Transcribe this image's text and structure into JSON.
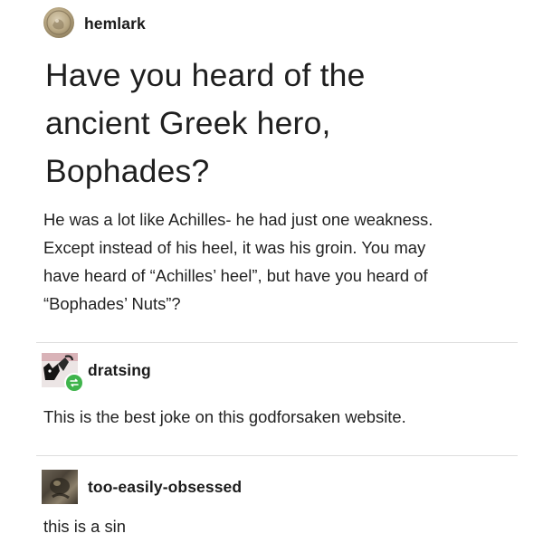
{
  "op": {
    "username": "hemlark",
    "title_lines": [
      "Have you heard of the",
      "ancient Greek hero,",
      "Bophades?"
    ],
    "body_lines": [
      "He was a lot like Achilles- he had just one weakness.",
      "Except instead of his heel, it was his groin. You may",
      "have heard of “Achilles’ heel”, but have you heard of",
      "“Bophades’ Nuts”?"
    ]
  },
  "replies": [
    {
      "username": "dratsing",
      "text": "This is the best joke on this godforsaken website.",
      "badge_icon": "reblog-icon",
      "badge_color": "#3fb44c"
    },
    {
      "username": "too-easily-obsessed",
      "text": "this is a sin"
    }
  ],
  "colors": {
    "text": "#1e1e1e",
    "divider": "#dedede",
    "background": "#ffffff"
  }
}
